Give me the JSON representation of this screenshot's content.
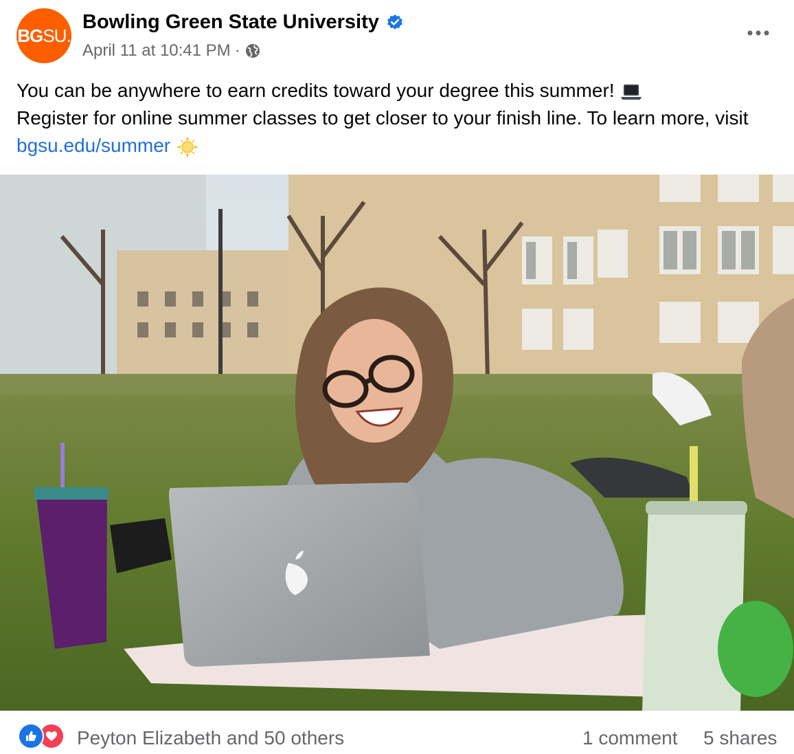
{
  "post": {
    "avatar": {
      "logo_bold": "BG",
      "logo_thin": "SU",
      "logo_dot": "."
    },
    "page_name": "Bowling Green State University",
    "timestamp": "April 11 at 10:41 PM",
    "separator": "·",
    "text_line1": "You can be anywhere to earn credits toward your degree this summer!",
    "text_line2": "Register for online summer classes to get closer to your finish line. To learn more, visit",
    "link_text": "bgsu.edu/summer",
    "icons": {
      "verified": "verified-badge-icon",
      "audience": "globe-icon",
      "more": "more-options-icon",
      "laptop_emoji": "laptop-emoji-icon",
      "sun_emoji": "sun-emoji-icon"
    }
  },
  "footer": {
    "reactions_text": "Peyton Elizabeth and 50 others",
    "comments": "1 comment",
    "shares": "5 shares"
  },
  "colors": {
    "brand": "#fd5f00",
    "link": "#216fdb",
    "secondary_text": "#65676b",
    "like": "#1b74e4",
    "love": "#f33e58"
  }
}
